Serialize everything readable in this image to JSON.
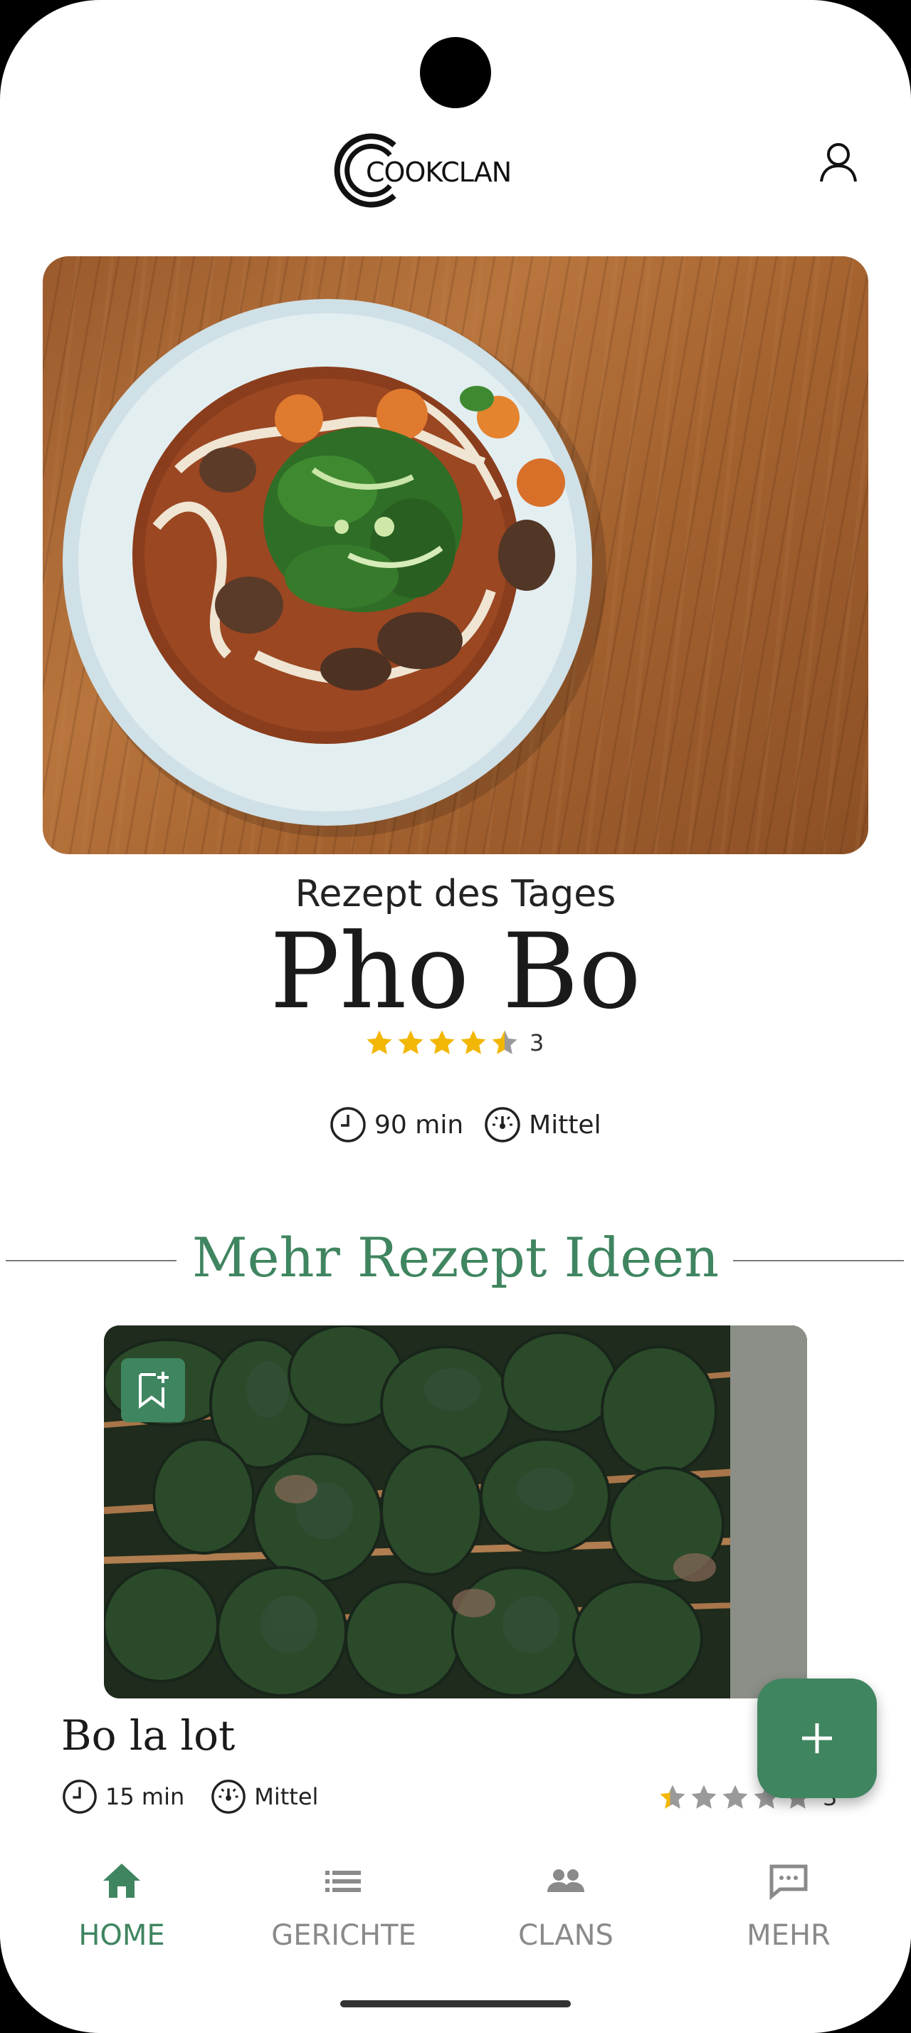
{
  "app": {
    "name": "COOKCLAN"
  },
  "hero": {
    "subtitle": "Rezept des Tages",
    "title": "Pho Bo",
    "rating_count": "3",
    "rating_value": 4.5,
    "time": "90 min",
    "difficulty": "Mittel"
  },
  "section": {
    "title": "Mehr Rezept Ideen"
  },
  "card": {
    "title": "Bo la lot",
    "time": "15 min",
    "difficulty": "Mittel",
    "rating_count": "3",
    "rating_value": 0.4
  },
  "nav": {
    "items": [
      {
        "label": "HOME",
        "icon": "home-icon",
        "active": true
      },
      {
        "label": "GERICHTE",
        "icon": "list-icon",
        "active": false
      },
      {
        "label": "CLANS",
        "icon": "people-icon",
        "active": false
      },
      {
        "label": "MEHR",
        "icon": "chat-icon",
        "active": false
      }
    ]
  },
  "colors": {
    "accent": "#3f8560",
    "star": "#f2b705",
    "star_empty": "#9a9a9a"
  }
}
